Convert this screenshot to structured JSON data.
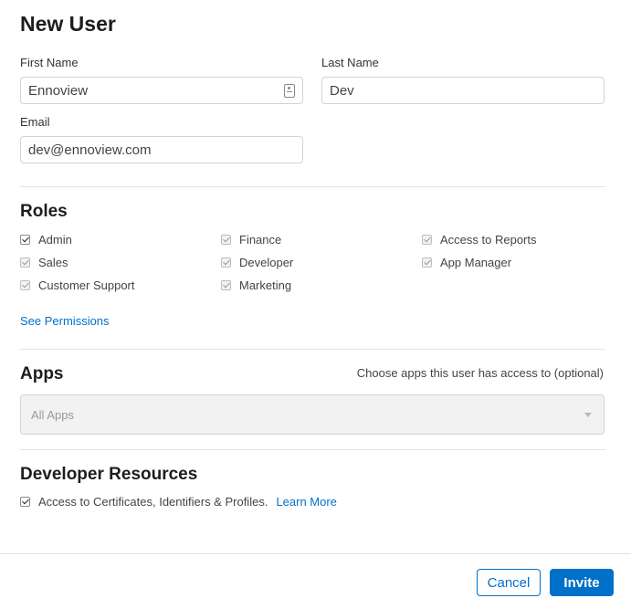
{
  "form": {
    "title": "New User"
  },
  "fields": {
    "first_name": {
      "label": "First Name",
      "value": "Ennoview"
    },
    "last_name": {
      "label": "Last Name",
      "value": "Dev"
    },
    "email": {
      "label": "Email",
      "value": "dev@ennoview.com"
    }
  },
  "roles": {
    "title": "Roles",
    "items": [
      {
        "label": "Admin",
        "checked": true,
        "enabled": true
      },
      {
        "label": "Sales",
        "checked": true,
        "enabled": false
      },
      {
        "label": "Customer Support",
        "checked": true,
        "enabled": false
      },
      {
        "label": "Finance",
        "checked": true,
        "enabled": false
      },
      {
        "label": "Developer",
        "checked": true,
        "enabled": false
      },
      {
        "label": "Marketing",
        "checked": true,
        "enabled": false
      },
      {
        "label": "Access to Reports",
        "checked": true,
        "enabled": false
      },
      {
        "label": "App Manager",
        "checked": true,
        "enabled": false
      }
    ],
    "see_permissions": "See Permissions"
  },
  "apps": {
    "title": "Apps",
    "hint": "Choose apps this user has access to (optional)",
    "selected": "All Apps"
  },
  "dev_resources": {
    "title": "Developer Resources",
    "checkbox_label": "Access to Certificates, Identifiers & Profiles.",
    "checked": true,
    "learn_more": "Learn More"
  },
  "actions": {
    "cancel": "Cancel",
    "invite": "Invite"
  },
  "colors": {
    "accent": "#0070c9",
    "title": "#1d1d1f",
    "border": "#d2d2d7"
  }
}
